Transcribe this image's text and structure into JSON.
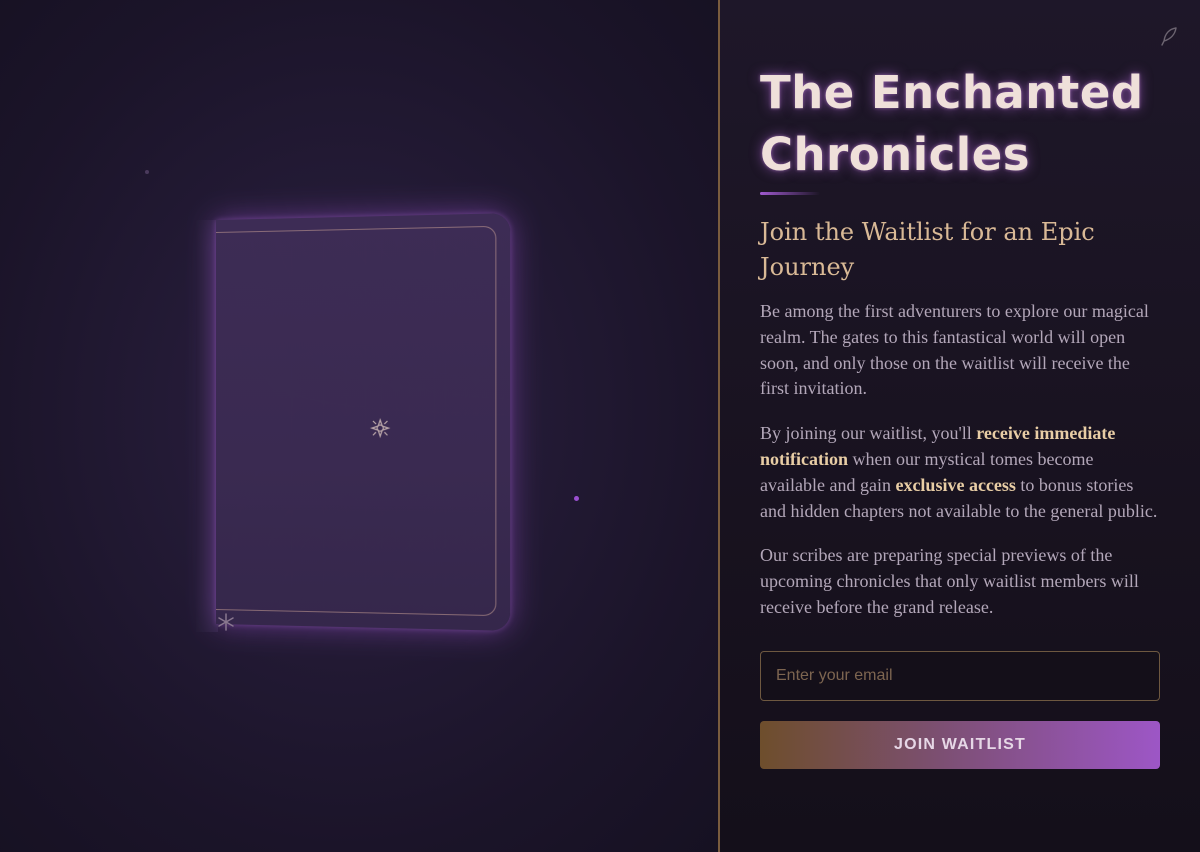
{
  "panel": {
    "title": "The Enchanted Chronicles",
    "subtitle": "Join the Waitlist for an Epic Journey",
    "paragraph_1": "Be among the first adventurers to explore our magical realm. The gates to this fantastical world will open soon, and only those on the waitlist will receive the first invitation.",
    "paragraph_2": {
      "part_1": "By joining our waitlist, you'll ",
      "emphasis_1": "receive immediate notification",
      "part_2": " when our mystical tomes become available and gain ",
      "emphasis_2": "exclusive access",
      "part_3": " to bonus stories and hidden chapters not available to the general public."
    },
    "paragraph_3": "Our scribes are preparing special previews of the upcoming chronicles that only waitlist members will receive before the grand release.",
    "email_placeholder": "Enter your email",
    "email_value": "",
    "button_label": "JOIN WAITLIST"
  },
  "icons": {
    "corner": "quill-icon",
    "book_emblem": "sparkle-icon",
    "book_corner": "star-icon"
  },
  "colors": {
    "background": "#1b1428",
    "accent_purple": "#9d56c6",
    "accent_gold": "#d9b996",
    "divider": "#7a5c3e"
  }
}
